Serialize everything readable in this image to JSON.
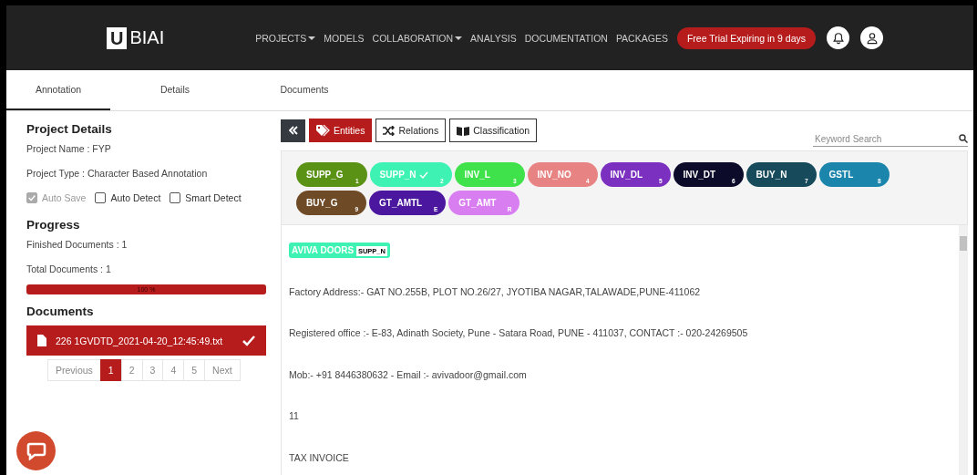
{
  "header": {
    "logo_letter": "U",
    "logo_rest": "BIAI",
    "nav": [
      {
        "label": "PROJECTS",
        "dropdown": true
      },
      {
        "label": "MODELS",
        "dropdown": false
      },
      {
        "label": "COLLABORATION",
        "dropdown": true
      },
      {
        "label": "ANALYSIS",
        "dropdown": false
      },
      {
        "label": "DOCUMENTATION",
        "dropdown": false
      },
      {
        "label": "PACKAGES",
        "dropdown": false
      }
    ],
    "trial_button": "Free Trial Expiring in 9 days"
  },
  "tabs": [
    {
      "label": "Annotation",
      "selected": true
    },
    {
      "label": "Details",
      "selected": false
    },
    {
      "label": "Documents",
      "selected": false
    }
  ],
  "project": {
    "title": "Project Details",
    "name": "Project Name : FYP",
    "type": "Project Type : Character Based Annotation",
    "options": [
      {
        "label": "Auto Save",
        "checked": true,
        "disabled": true
      },
      {
        "label": "Auto Detect",
        "checked": false,
        "disabled": false
      },
      {
        "label": "Smart Detect",
        "checked": false,
        "disabled": false
      }
    ]
  },
  "progress": {
    "title": "Progress",
    "finished": "Finished Documents : 1",
    "total": "Total Documents : 1",
    "level": 1,
    "reading": "100 %"
  },
  "documents": {
    "title": "Documents",
    "items": [
      {
        "name": "226 1GVDTD_2021-04-20_12:45:49.txt",
        "selected": true,
        "done": true
      }
    ],
    "pagination": [
      {
        "label": "Previous",
        "selected": false
      },
      {
        "label": "1",
        "selected": true
      },
      {
        "label": "2",
        "selected": false
      },
      {
        "label": "3",
        "selected": false
      },
      {
        "label": "4",
        "selected": false
      },
      {
        "label": "5",
        "selected": false
      },
      {
        "label": "Next",
        "selected": false
      }
    ]
  },
  "toolbar": {
    "modes": [
      {
        "label": "Entities",
        "selected": true,
        "kind": "tag"
      },
      {
        "label": "Relations",
        "selected": false,
        "kind": "shuffle"
      },
      {
        "label": "Classification",
        "selected": false,
        "kind": "book"
      }
    ],
    "search": {
      "placeholder": "Keyword Search"
    }
  },
  "entities": [
    {
      "label": "SUPP_G",
      "key": "1",
      "color": "#5a9216",
      "selected": false
    },
    {
      "label": "SUPP_N",
      "key": "2",
      "color": "#3ef2b4",
      "selected": true
    },
    {
      "label": "INV_L",
      "key": "3",
      "color": "#3fe24a",
      "selected": false
    },
    {
      "label": "INV_NO",
      "key": "4",
      "color": "#e88383",
      "selected": false
    },
    {
      "label": "INV_DL",
      "key": "5",
      "color": "#7b30c0",
      "selected": false
    },
    {
      "label": "INV_DT",
      "key": "6",
      "color": "#0c0c2a",
      "selected": false
    },
    {
      "label": "BUY_N",
      "key": "7",
      "color": "#174a5a",
      "selected": false
    },
    {
      "label": "GSTL",
      "key": "8",
      "color": "#1b85ac",
      "selected": false
    },
    {
      "label": "BUY_G",
      "key": "9",
      "color": "#6e4b26",
      "selected": false
    },
    {
      "label": "GT_AMTL",
      "key": "E",
      "color": "#4a179e",
      "selected": false
    },
    {
      "label": "GT_AMT",
      "key": "R",
      "color": "#d87ef0",
      "selected": false
    }
  ],
  "document_lines": [
    {
      "kind": "entity",
      "text": "AVIVA DOORS",
      "label": "SUPP_N",
      "color": "#3ef2b4"
    },
    {
      "kind": "text",
      "text": "Factory Address:- GAT NO.255B, PLOT NO.26/27, JYOTIBA NAGAR,TALAWADE,PUNE-411062"
    },
    {
      "kind": "text",
      "text": "Registered office :- E-83, Adinath Society, Pune - Satara Road, PUNE - 411037, CONTACT :- 020-24269505"
    },
    {
      "kind": "text",
      "text": "Mob:- +91 8446380632 - Email :- avivadoor@gmail.com"
    },
    {
      "kind": "text",
      "text": "11"
    },
    {
      "kind": "text",
      "text": "TAX INVOICE"
    }
  ]
}
